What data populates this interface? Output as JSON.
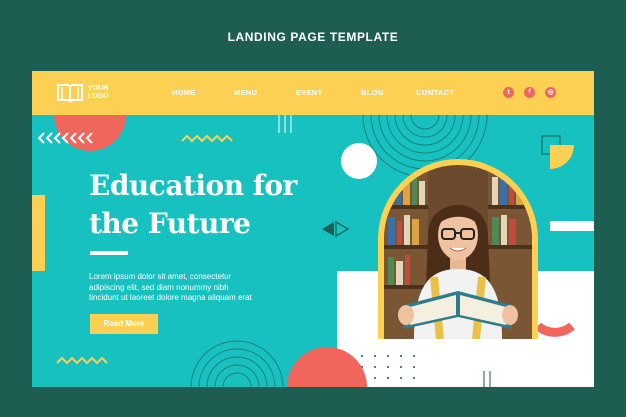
{
  "page": {
    "title": "LANDING PAGE TEMPLATE"
  },
  "logo": {
    "line1": "YOUR",
    "line2": "LOGO"
  },
  "nav": [
    {
      "label": "HOME"
    },
    {
      "label": "MENU"
    },
    {
      "label": "EVENT"
    },
    {
      "label": "BLOG"
    },
    {
      "label": "CONTACT"
    }
  ],
  "social": {
    "twitter": "t",
    "facebook": "f",
    "instagram": "◎"
  },
  "hero": {
    "headline_line1": "Education for",
    "headline_line2": "the Future",
    "body_line1": "Lorem ipsum dolor sit amet, consectetur",
    "body_line2": "adipiscing elit, sed diam nonummy nibh",
    "body_line3": "tincidunt ut laoreet dolore magna aliquam erat",
    "cta_label": "Read More"
  },
  "colors": {
    "background": "#1e5d52",
    "hero": "#17c1c0",
    "accent_yellow": "#fcd052",
    "accent_coral": "#f0665d",
    "white": "#ffffff"
  }
}
